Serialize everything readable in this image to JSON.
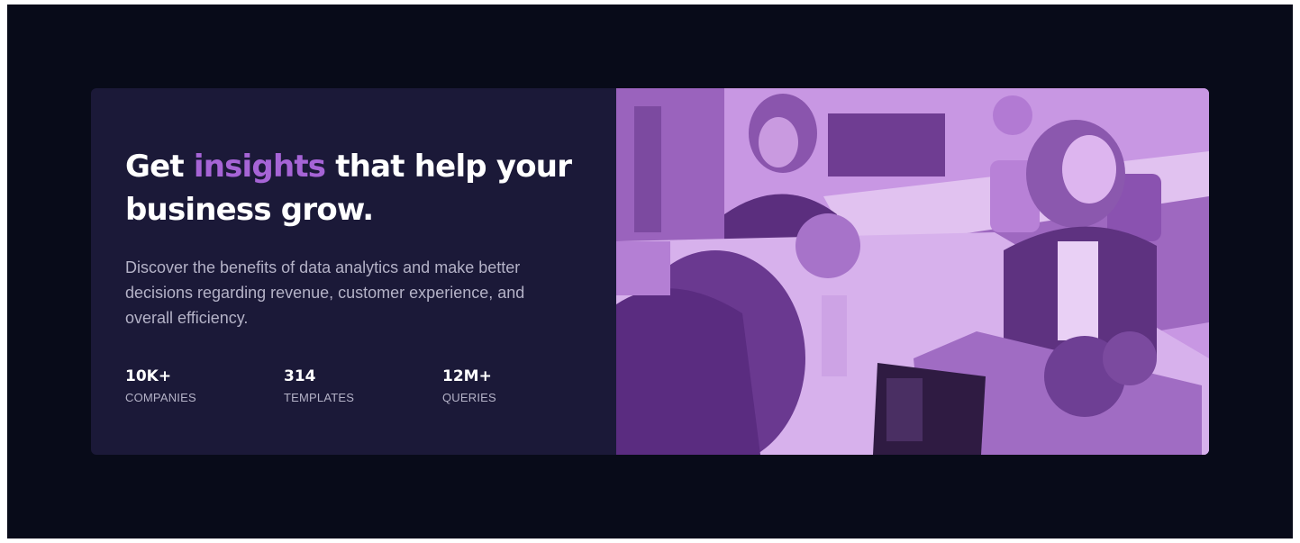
{
  "hero": {
    "headline_start": "Get ",
    "headline_accent": "insights",
    "headline_end": " that help your business grow.",
    "description": "Discover the benefits of data analytics and make better decisions regarding revenue, customer experience, and overall efficiency."
  },
  "stats": [
    {
      "value": "10K+",
      "label": "COMPANIES"
    },
    {
      "value": "314",
      "label": "TEMPLATES"
    },
    {
      "value": "12M+",
      "label": "QUERIES"
    }
  ],
  "colors": {
    "background": "#080b19",
    "card": "#1b1938",
    "accent": "#a664d6",
    "image_overlay": "#aa5cdb"
  }
}
